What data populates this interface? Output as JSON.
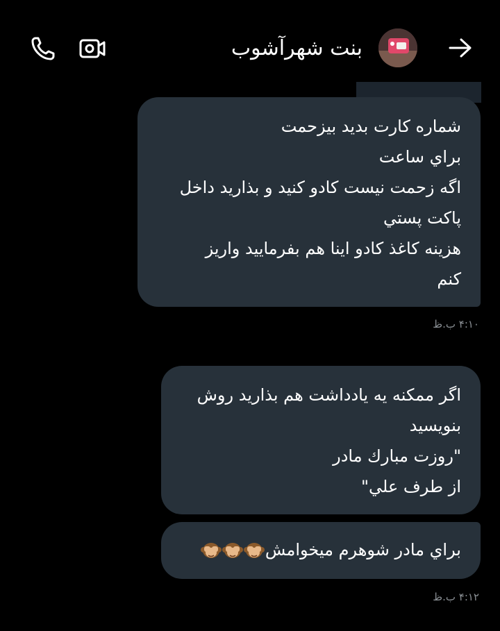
{
  "header": {
    "contact_name": "بنت شهرآشوب",
    "icons": {
      "call": "phone-icon",
      "video": "video-camera-icon",
      "back": "arrow-right-icon"
    }
  },
  "messages": [
    {
      "lines": [
        "شماره كارت بديد بيزحمت",
        "براي ساعت",
        "اگه زحمت نيست كادو كنيد و بذاريد داخل",
        "پاكت پستي",
        "هزينه كاغذ كادو اينا هم بفرماييد واريز",
        "كنم"
      ],
      "time": "۴:۱۰ ب.ظ"
    },
    {
      "lines": [
        "اگر ممكنه يه يادداشت هم بذاريد روش",
        "بنويسيد",
        "\"روزت مبارك مادر",
        "از طرف علي\""
      ]
    },
    {
      "lines": [
        "براي مادر شوهرم ميخوامش"
      ],
      "emoji": "see-no-evil-monkey-icon",
      "emoji_count": 3,
      "time": "۴:۱۲ ب.ظ"
    }
  ],
  "colors": {
    "background": "#000000",
    "bubble": "#27313a",
    "text": "#ffffff",
    "timestamp": "#8a8f94"
  }
}
